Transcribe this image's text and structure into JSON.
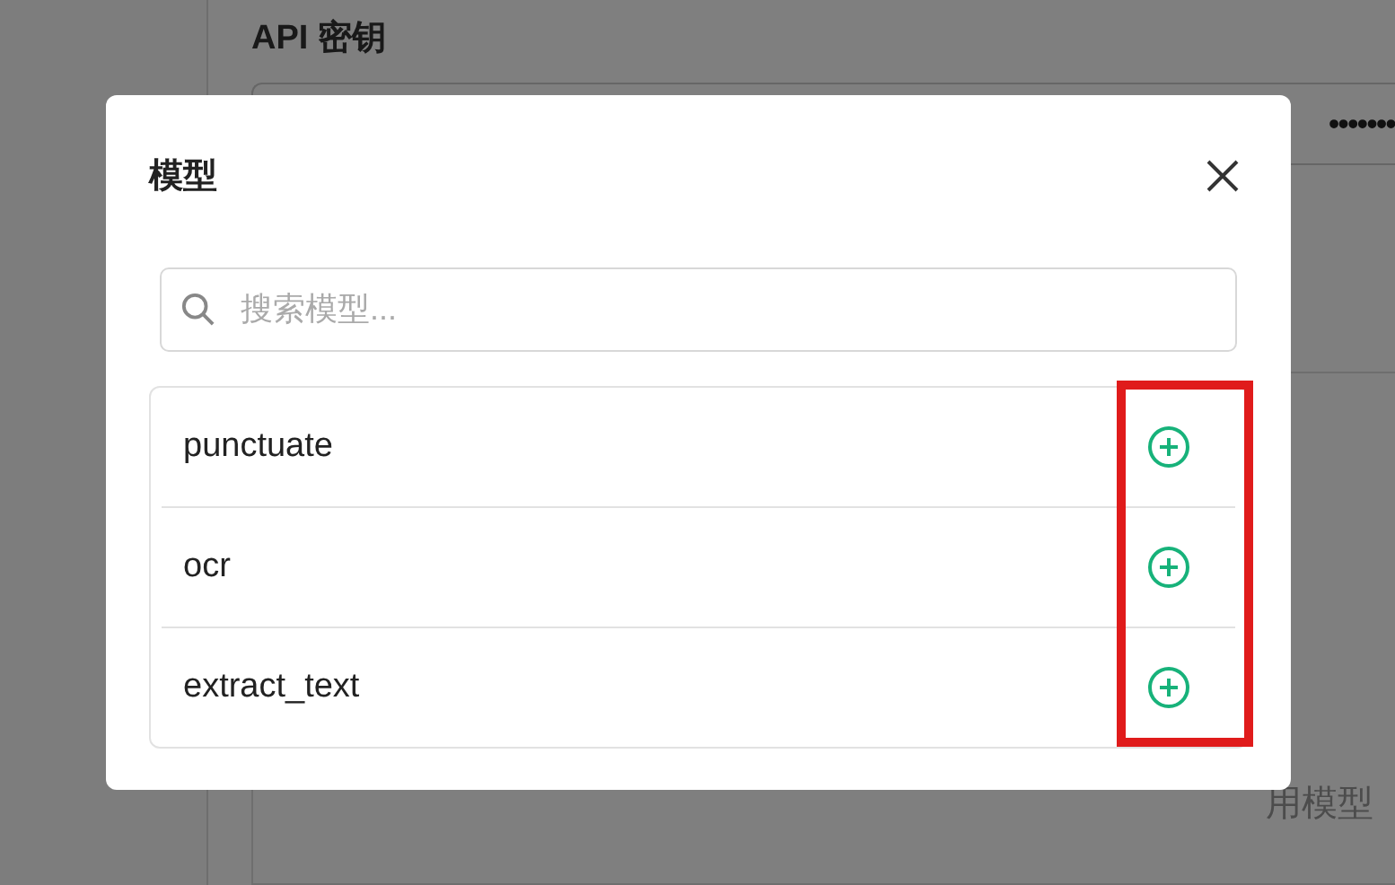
{
  "background": {
    "api_key_label": "API 密钥",
    "api_key_value": "•••••••",
    "empty_text": "用模型"
  },
  "dialog": {
    "title": "模型",
    "search": {
      "placeholder": "搜索模型..."
    },
    "models": [
      {
        "name": "punctuate"
      },
      {
        "name": "ocr"
      },
      {
        "name": "extract_text"
      }
    ],
    "highlight": true
  }
}
